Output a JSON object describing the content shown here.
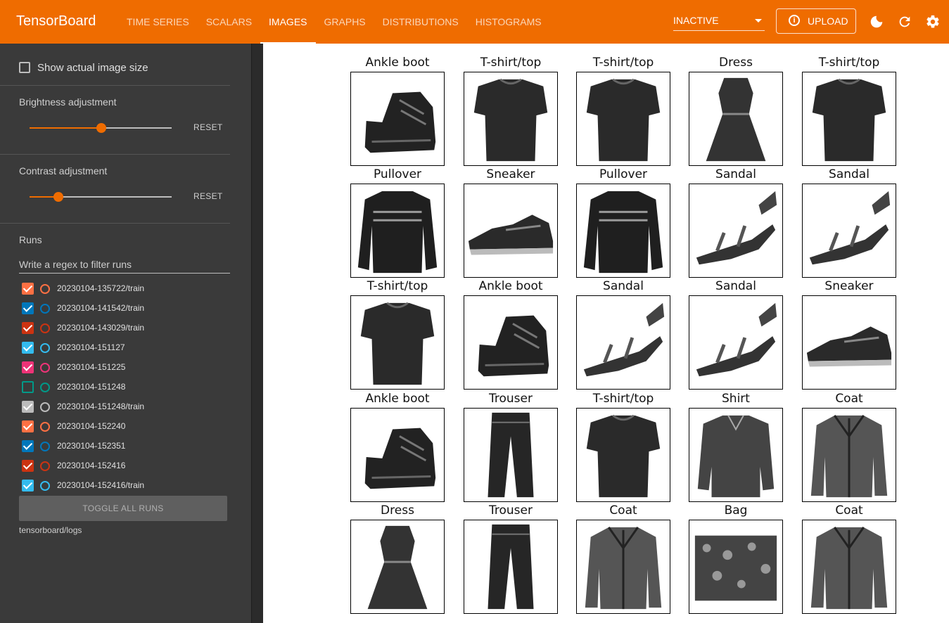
{
  "app": {
    "title": "TensorBoard"
  },
  "nav": {
    "tabs": [
      "TIME SERIES",
      "SCALARS",
      "IMAGES",
      "GRAPHS",
      "DISTRIBUTIONS",
      "HISTOGRAMS"
    ],
    "active_tab": "IMAGES"
  },
  "header": {
    "reload_status": "INACTIVE",
    "upload_label": "UPLOAD",
    "icons": [
      "dark-mode-icon",
      "refresh-icon",
      "settings-icon"
    ]
  },
  "sidebar": {
    "show_actual_size_label": "Show actual image size",
    "brightness": {
      "label": "Brightness adjustment",
      "reset": "RESET",
      "level": 0.5
    },
    "contrast": {
      "label": "Contrast adjustment",
      "reset": "RESET",
      "level": 0.2
    },
    "runs_title": "Runs",
    "runs_filter_placeholder": "Write a regex to filter runs",
    "runs": [
      {
        "name": "20230104-135722/train",
        "color": "#ff7043",
        "checked": true
      },
      {
        "name": "20230104-141542/train",
        "color": "#0077bb",
        "checked": true
      },
      {
        "name": "20230104-143029/train",
        "color": "#cc3311",
        "checked": true
      },
      {
        "name": "20230104-151127",
        "color": "#33bbee",
        "checked": true
      },
      {
        "name": "20230104-151225",
        "color": "#ee3377",
        "checked": true
      },
      {
        "name": "20230104-151248",
        "color": "#009988",
        "checked": false
      },
      {
        "name": "20230104-151248/train",
        "color": "#bbbbbb",
        "checked": true
      },
      {
        "name": "20230104-152240",
        "color": "#ff7043",
        "checked": true
      },
      {
        "name": "20230104-152351",
        "color": "#0077bb",
        "checked": true
      },
      {
        "name": "20230104-152416",
        "color": "#cc3311",
        "checked": true
      },
      {
        "name": "20230104-152416/train",
        "color": "#33bbee",
        "checked": true
      }
    ],
    "toggle_all_label": "TOGGLE ALL RUNS",
    "logdir": "tensorboard/logs"
  },
  "images": {
    "captions": [
      "Ankle boot",
      "T-shirt/top",
      "T-shirt/top",
      "Dress",
      "T-shirt/top",
      "Pullover",
      "Sneaker",
      "Pullover",
      "Sandal",
      "Sandal",
      "T-shirt/top",
      "Ankle boot",
      "Sandal",
      "Sandal",
      "Sneaker",
      "Ankle boot",
      "Trouser",
      "T-shirt/top",
      "Shirt",
      "Coat",
      "Dress",
      "Trouser",
      "Coat",
      "Bag",
      "Coat"
    ]
  },
  "colors": {
    "accent": "#ef6c00",
    "sidebar_bg": "#3a3a3a"
  }
}
